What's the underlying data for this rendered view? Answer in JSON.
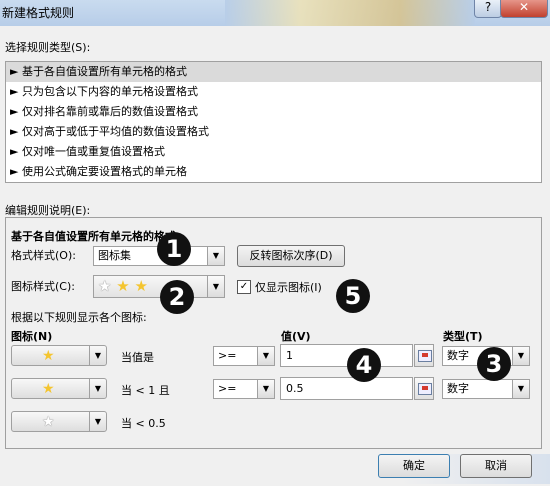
{
  "window": {
    "title": "新建格式规则",
    "help_glyph": "?",
    "close_glyph": "✕"
  },
  "rule_type": {
    "label": "选择规则类型(S):",
    "items": [
      "► 基于各自值设置所有单元格的格式",
      "► 只为包含以下内容的单元格设置格式",
      "► 仅对排名靠前或靠后的数值设置格式",
      "► 仅对高于或低于平均值的数值设置格式",
      "► 仅对唯一值或重复值设置格式",
      "► 使用公式确定要设置格式的单元格"
    ],
    "selected_index": 0
  },
  "edit": {
    "label": "编辑规则说明(E):",
    "heading": "基于各自值设置所有单元格的格式:",
    "format_style_label": "格式样式(O):",
    "format_style_value": "图标集",
    "reverse_button": "反转图标次序(D)",
    "icon_style_label": "图标样式(C):",
    "icon_style_value": "★ ★ ★",
    "show_icon_only_label": "仅显示图标(I)",
    "show_icon_only_checked": "✓",
    "rules_label": "根据以下规则显示各个图标:",
    "col_icon": "图标(N)",
    "col_value": "值(V)",
    "col_type": "类型(T)",
    "rows": [
      {
        "star": "★",
        "cond_text": "当值是",
        "operator": ">=",
        "value": "1",
        "type": "数字"
      },
      {
        "star": "★",
        "cond_text": "当 < 1 且",
        "operator": ">=",
        "value": "0.5",
        "type": "数字"
      },
      {
        "star": "★",
        "cond_text": "当 < 0.5"
      }
    ]
  },
  "badges": [
    "1",
    "2",
    "3",
    "4",
    "5"
  ],
  "footer": {
    "ok": "确定",
    "cancel": "取消"
  },
  "icons": {
    "dropdown": "▼",
    "more": "▾"
  }
}
